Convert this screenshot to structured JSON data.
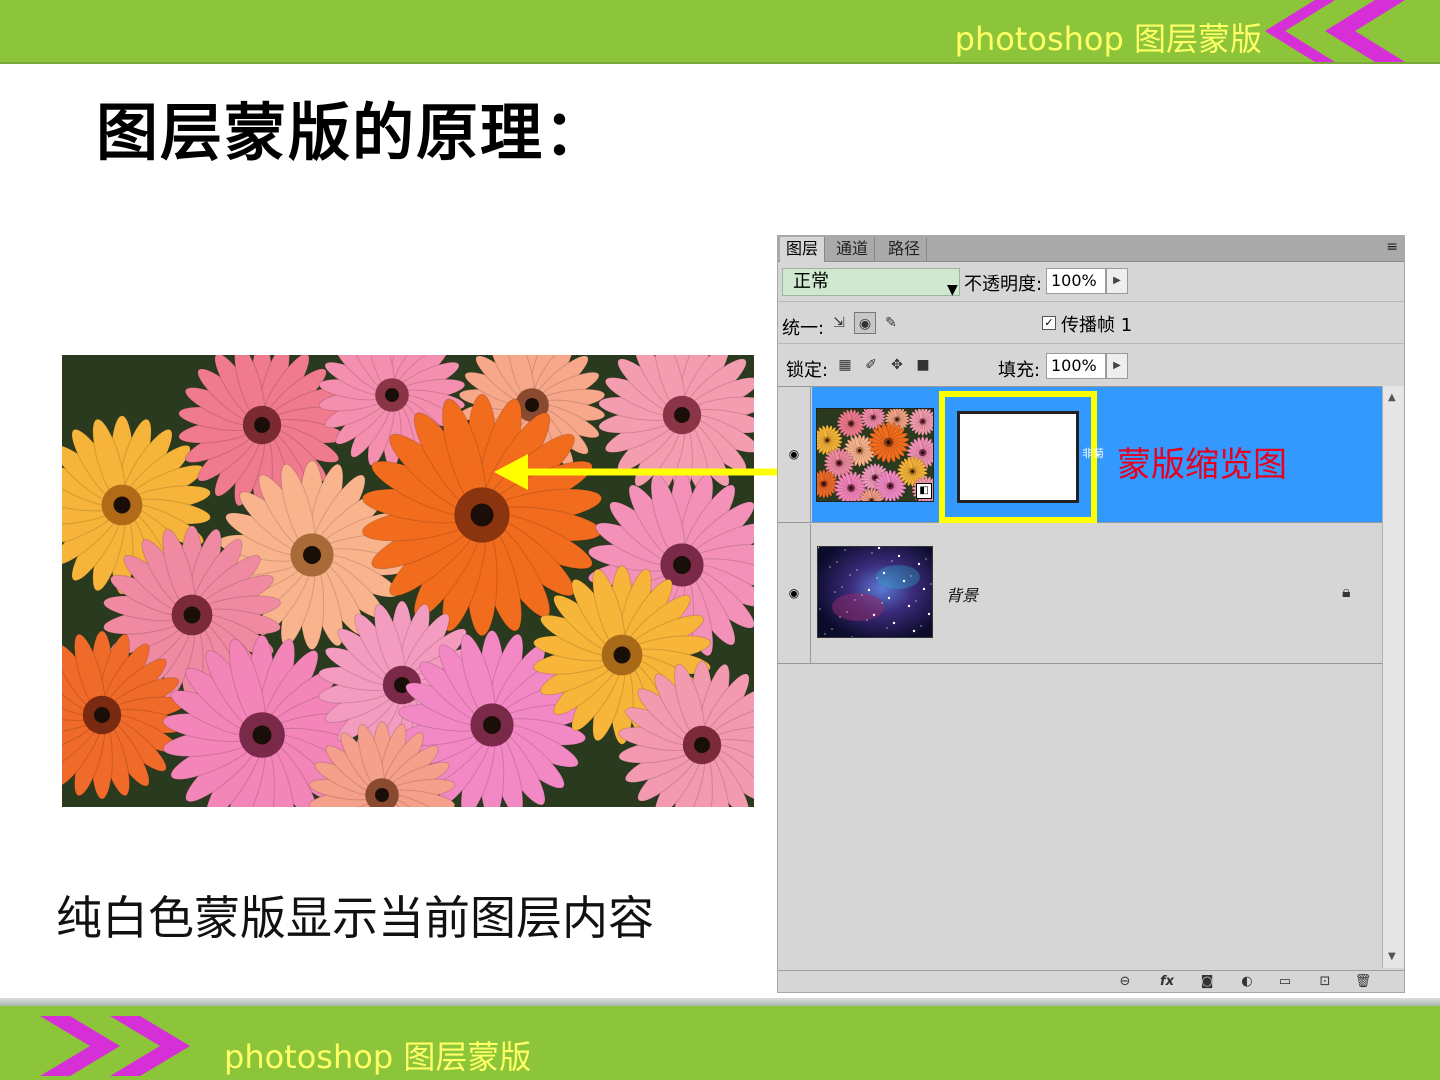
{
  "header": {
    "title": "photoshop 图层蒙版"
  },
  "slide": {
    "title": "图层蒙版的原理：",
    "caption": "纯白色蒙版显示当前图层内容"
  },
  "panel": {
    "tabs": [
      {
        "label": "图层"
      },
      {
        "label": "通道"
      },
      {
        "label": "路径"
      }
    ],
    "menu_icon": "≡",
    "blend_mode": "正常",
    "opacity_label": "不透明度:",
    "opacity_value": "100%",
    "unify_label": "统一:",
    "propagate_label": "传播帧 1",
    "lock_label": "锁定:",
    "fill_label": "填充:",
    "fill_value": "100%",
    "layers": [
      {
        "name": "非菊",
        "mask_label": "蒙版缩览图"
      },
      {
        "name": "背景"
      }
    ]
  },
  "footer": {
    "title": "photoshop 图层蒙版"
  },
  "colors": {
    "bar_green": "#8cc43a",
    "title_yellow": "#ffff66",
    "chevron_magenta": "#d62fd8",
    "selected_layer": "#3399ff",
    "mask_highlight": "#ffff00",
    "annotation_red": "#e8001e"
  }
}
